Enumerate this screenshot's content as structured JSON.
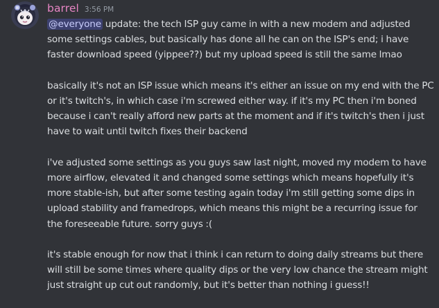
{
  "message": {
    "username": "barrel",
    "timestamp": "3:56 PM",
    "mention": "@everyone",
    "first_paragraph_rest": " update: the tech ISP guy came in with a new modem and adjusted some settings cables, but basically has done all he can on the ISP's end; i have faster download speed (yippee??) but my upload speed is still the same lmao",
    "paragraphs": [
      "basically it's not an ISP issue which means it's either an issue on my end with the PC or it's twitch's, in which case i'm screwed either way. if it's my PC then i'm boned because i can't really afford new parts at the moment and if it's twitch's then i just have to wait until twitch fixes their backend",
      "i've adjusted some settings as you guys saw last night, moved my modem to have more airflow, elevated it and changed some settings which means hopefully it's more stable-ish, but after some testing again today i'm still getting some dips in upload stability and framedrops, which means this might be a recurring issue for the foreseeable future. sorry guys :(",
      "it's stable enough for now that i think i can return to doing daily streams but there will still be some times where quality dips or the very low chance the stream might just straight up cut out randomly, but it's better than nothing i guess!!"
    ]
  },
  "colors": {
    "background": "#313338",
    "username": "#e785c4",
    "timestamp": "#949ba4",
    "text": "#dbdee1",
    "mention_text": "#c9cdfb",
    "mention_bg": "rgba(88,101,242,0.3)"
  },
  "icons": {
    "avatar": "user-avatar-image"
  }
}
